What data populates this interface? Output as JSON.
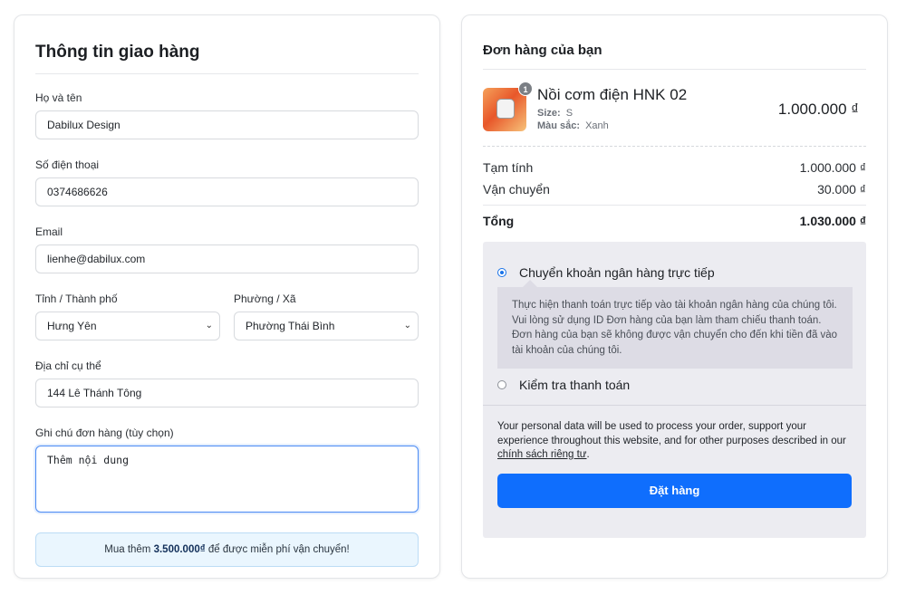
{
  "shipping": {
    "title": "Thông tin giao hàng",
    "name_label": "Họ và tên",
    "name_value": "Dabilux Design",
    "phone_label": "Số điện thoại",
    "phone_value": "0374686626",
    "email_label": "Email",
    "email_value": "lienhe@dabilux.com",
    "province_label": "Tỉnh / Thành phố",
    "province_value": "Hưng Yên",
    "ward_label": "Phường / Xã",
    "ward_value": "Phường Thái Bình",
    "address_label": "Địa chỉ cụ thể",
    "address_value": "144 Lê Thánh Tông",
    "note_label": "Ghi chú đơn hàng (tùy chọn)",
    "note_value": "Thêm nội dung",
    "promo_prefix": "Mua thêm ",
    "promo_amount": "3.500.000₫",
    "promo_suffix": " để được miễn phí vận chuyển!"
  },
  "order": {
    "title": "Đơn hàng của bạn",
    "product": {
      "quantity": "1",
      "name": "Nồi cơm điện HNK 02",
      "size_label": "Size:",
      "size_value": "S",
      "color_label": "Màu sắc:",
      "color_value": "Xanh",
      "price": "1.000.000 ₫"
    },
    "subtotal_label": "Tạm tính",
    "subtotal_value": "1.000.000 ₫",
    "shipping_label": "Vận chuyển",
    "shipping_value": "30.000 ₫",
    "total_label": "Tổng",
    "total_value": "1.030.000 ₫"
  },
  "payment": {
    "bank_label": "Chuyển khoản ngân hàng trực tiếp",
    "bank_desc": "Thực hiện thanh toán trực tiếp vào tài khoản ngân hàng của chúng tôi. Vui lòng sử dụng ID Đơn hàng của bạn làm tham chiếu thanh toán. Đơn hàng của bạn sẽ không được vận chuyển cho đến khi tiền đã vào tài khoản của chúng tôi.",
    "check_label": "Kiểm tra thanh toán",
    "privacy_text": "Your personal data will be used to process your order, support your experience throughout this website, and for other purposes described in our ",
    "privacy_link": "chính sách riêng tư",
    "privacy_end": ".",
    "order_button": "Đặt hàng"
  },
  "colors": {
    "primary_button": "#0f6efd",
    "focus_border": "#4a8af4",
    "promo_bg": "#eaf6fe"
  }
}
